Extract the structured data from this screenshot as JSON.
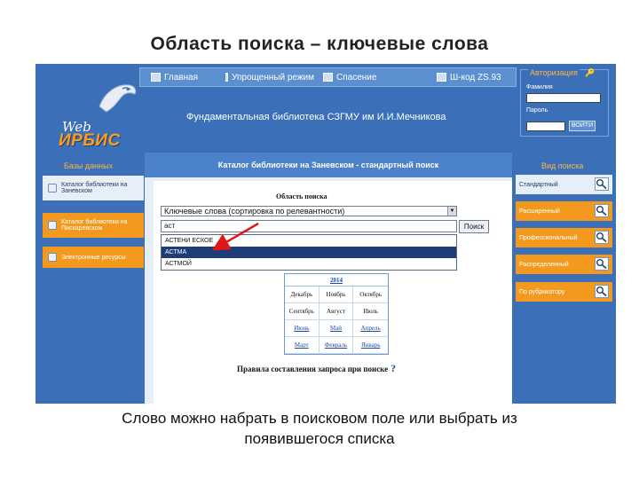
{
  "slide": {
    "title": "Область поиска – ключевые слова",
    "caption_line1": "Слово можно набрать в поисковом поле или выбрать из",
    "caption_line2": "появившегося списка"
  },
  "colors": {
    "page_blue": "#3b70b8",
    "accent_orange": "#f39a1e",
    "highlight": "#1e3c78",
    "arrow": "#e0161b"
  },
  "nav": {
    "items": [
      {
        "label": "Главная",
        "icon": "home-icon"
      },
      {
        "label": "Упрощенный режим",
        "icon": "page-icon"
      },
      {
        "label": "Спасение",
        "icon": "page-icon"
      },
      {
        "label": "Ш-код ZS.93",
        "icon": "book-icon"
      }
    ]
  },
  "logo": {
    "web": "Web",
    "irbis": "ИРБИС"
  },
  "header": {
    "library": "Фундаментальная библиотека СЗГМУ им И.И.Мечникова"
  },
  "auth": {
    "title": "Авторизация",
    "login_label": "Фамилия",
    "password_label": "Пароль",
    "submit_label": "ВОЙТИ"
  },
  "left": {
    "header": "Базы данных",
    "items": [
      {
        "label": "Каталог библиотеки на Заневском"
      },
      {
        "label": "Каталог библиотеки на Пискаревском"
      },
      {
        "label": "Электронные ресурсы"
      }
    ]
  },
  "right": {
    "header": "Вид поиска",
    "items": [
      {
        "label": "Стандартный"
      },
      {
        "label": "Расширенный"
      },
      {
        "label": "Профессиональный"
      },
      {
        "label": "Распределенный"
      },
      {
        "label": "По рубрикатору"
      }
    ]
  },
  "main": {
    "title": "Каталог библиотеки на Заневском - стандартный поиск",
    "area_label": "Область поиска",
    "select_value": "Ключевые слова (сортировка по релевантности)",
    "query_value": "аст",
    "search_button": "Поиск",
    "suggestions": [
      "АСТЕНИ ЕСКОЕ",
      "АСТМА",
      "АСТМОЙ"
    ],
    "calendar": {
      "year": "2014",
      "rows": [
        [
          "Декабрь",
          "Ноябрь",
          "Октябрь"
        ],
        [
          "Сентябрь",
          "Август",
          "Июль"
        ],
        [
          "Июнь",
          "Май",
          "Апрель"
        ],
        [
          "Март",
          "Февраль",
          "Январь"
        ]
      ]
    },
    "rules_text": "Правила составления запроса при поиске",
    "rules_mark": "?"
  }
}
